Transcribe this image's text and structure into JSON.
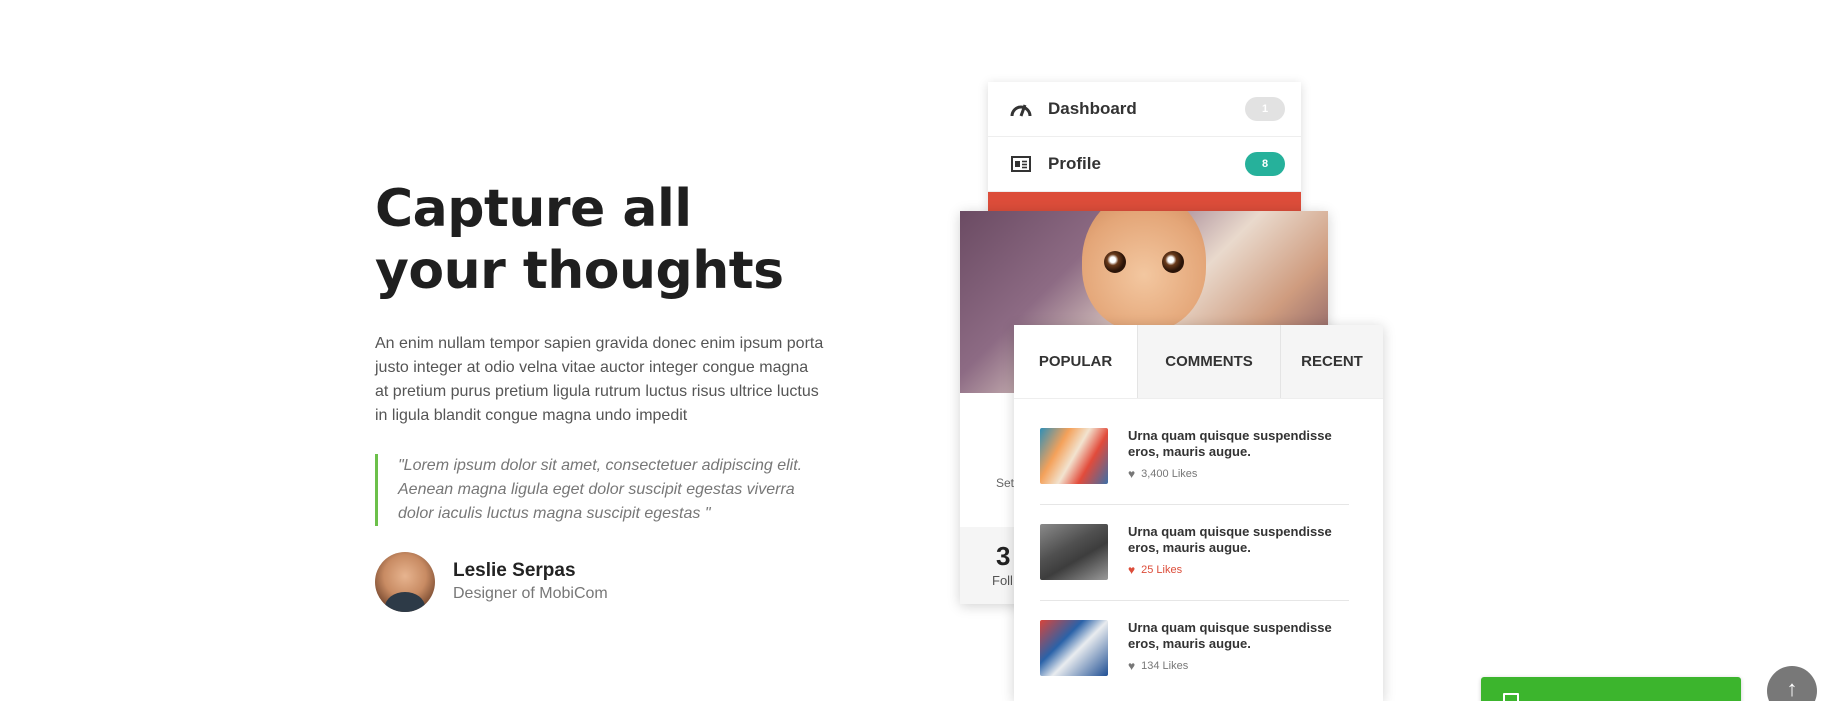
{
  "hero": {
    "headline": "Capture all your thoughts",
    "intro": "An enim nullam tempor sapien gravida donec enim ipsum porta justo integer at odio velna vitae auctor integer congue magna at pretium purus pretium ligula rutrum luctus risus ultrice luctus in ligula blandit congue magna undo impedit",
    "quote": "\"Lorem ipsum dolor sit amet, consectetuer adipiscing elit. Aenean magna ligula eget dolor suscipit egestas viverra dolor iaculis luctus magna suscipit egestas \"",
    "author_name": "Leslie Serpas",
    "author_role": "Designer of MobiCom"
  },
  "menu": {
    "items": [
      {
        "label": "Dashboard",
        "badge": "1",
        "icon": "gauge-icon"
      },
      {
        "label": "Profile",
        "badge": "8",
        "icon": "id-card-icon"
      }
    ]
  },
  "profile": {
    "partial_label": "Set",
    "partial_stat": "3",
    "partial_stat_label": "Foll"
  },
  "tabs": {
    "labels": [
      "POPULAR",
      "COMMENTS",
      "RECENT"
    ],
    "active": "POPULAR"
  },
  "posts": [
    {
      "title": "Urna quam quisque suspendisse eros, mauris augue.",
      "likes": "3,400 Likes",
      "liked": false
    },
    {
      "title": "Urna quam quisque suspendisse eros, mauris augue.",
      "likes": "25 Likes",
      "liked": true
    },
    {
      "title": "Urna quam quisque suspendisse eros, mauris augue.",
      "likes": "134 Likes",
      "liked": false
    }
  ],
  "colors": {
    "accent_green": "#6cc04a",
    "badge_teal": "#26b19b",
    "menu_red": "#dc4d3a",
    "chat_green": "#3cb52d",
    "like_red": "#dc4d3a"
  },
  "icons": {
    "chat": "chat-icon",
    "back_to_top": "arrow-up-icon",
    "heart": "heart-icon"
  }
}
